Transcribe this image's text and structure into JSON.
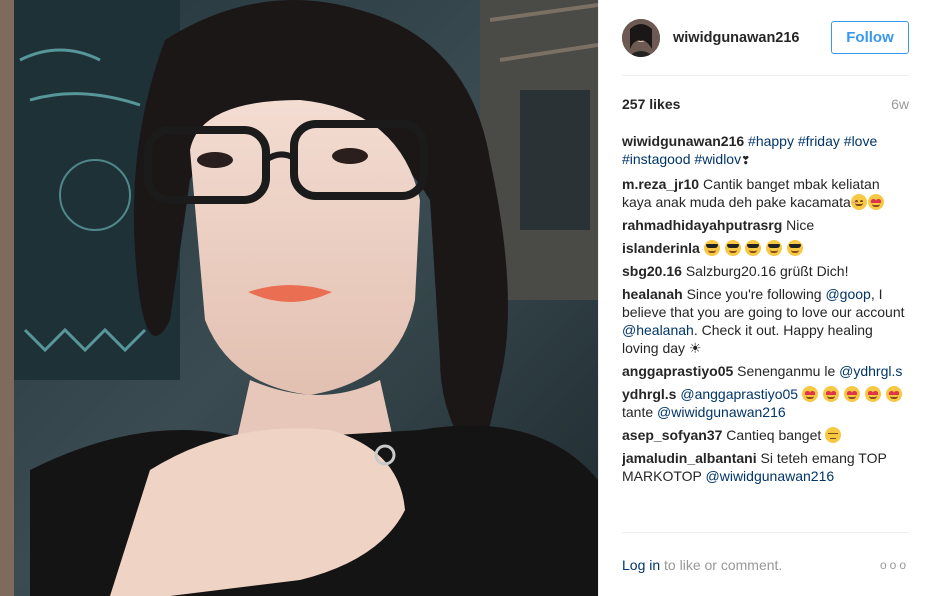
{
  "post": {
    "username": "wiwidgunawan216",
    "follow_label": "Follow",
    "likes": "257 likes",
    "age": "6w",
    "caption": {
      "user": "wiwidgunawan216",
      "tags": [
        "#happy",
        "#friday",
        "#love",
        "#instagood",
        "#widlov"
      ],
      "tail": "❣"
    }
  },
  "comments": [
    {
      "user": "m.reza_jr10",
      "text": "Cantik banget mbak keliatan kaya anak muda deh pake kacamata",
      "emoji": [
        "smile",
        "heart-eyes"
      ]
    },
    {
      "user": "rahmadhidayahputrasrg",
      "text": "Nice",
      "emoji": []
    },
    {
      "user": "islanderinla",
      "text": "",
      "emoji": [
        "sunglasses",
        "sunglasses",
        "sunglasses",
        "sunglasses",
        "sunglasses"
      ]
    },
    {
      "user": "sbg20.16",
      "text": "Salzburg20.16 grüßt Dich!",
      "emoji": []
    },
    {
      "user": "healanah",
      "text_a": "Since you're following",
      "mention_a": "@goop",
      "text_b": ", I believe that you are going to love our account",
      "mention_b": "@healanah",
      "text_c": ". Check it out. Happy healing loving day ☀",
      "emoji": []
    },
    {
      "user": "anggaprastiyo05",
      "text": "Senenganmu le",
      "mention": "@ydhrgl.s",
      "emoji": []
    },
    {
      "user": "ydhrgl.s",
      "mention_a": "@anggaprastiyo05",
      "text_b": "tante",
      "mention_b": "@wiwidgunawan216",
      "emoji": [
        "heart-eyes",
        "heart-eyes",
        "heart-eyes",
        "heart-eyes",
        "heart-eyes"
      ]
    },
    {
      "user": "asep_sofyan37",
      "text": "Cantieq banget",
      "emoji": [
        "pensive"
      ]
    },
    {
      "user": "jamaludin_albantani",
      "text": "Si teteh emang TOP MARKOTOP",
      "mention": "@wiwidgunawan216",
      "emoji": []
    }
  ],
  "footer": {
    "login_label": "Log in",
    "prompt": "to like or comment.",
    "more": "ooo"
  },
  "icons": {
    "more": "more-options-icon"
  },
  "colors": {
    "link": "#003569",
    "accent": "#3897f0",
    "muted": "#999999",
    "text": "#262626"
  }
}
